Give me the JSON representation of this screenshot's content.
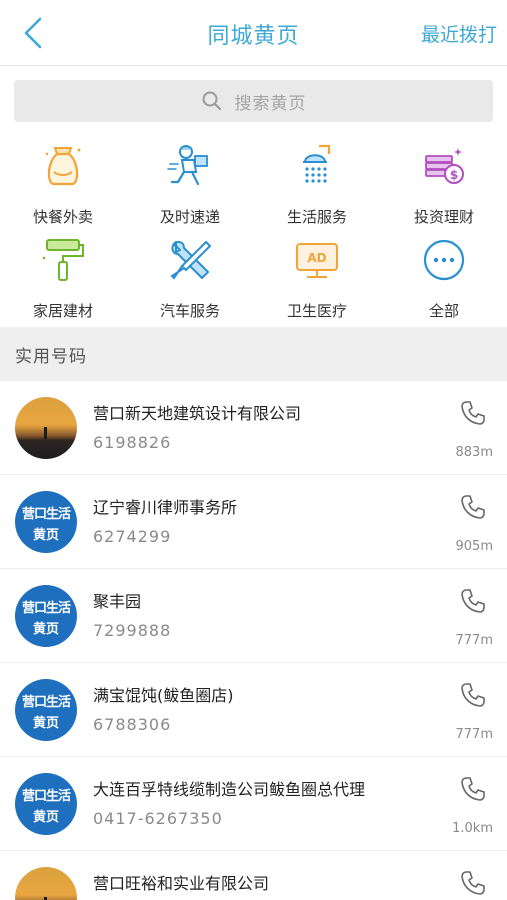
{
  "header": {
    "title": "同城黄页",
    "recent_label": "最近拨打"
  },
  "search": {
    "placeholder": "搜索黄页"
  },
  "categories": [
    {
      "label": "快餐外卖",
      "icon": "takeout-bag-icon"
    },
    {
      "label": "及时速递",
      "icon": "courier-icon"
    },
    {
      "label": "生活服务",
      "icon": "shower-icon"
    },
    {
      "label": "投资理财",
      "icon": "money-stack-icon"
    },
    {
      "label": "家居建材",
      "icon": "paint-roller-icon"
    },
    {
      "label": "汽车服务",
      "icon": "wrench-screwdriver-icon"
    },
    {
      "label": "卫生医疗",
      "icon": "ad-monitor-icon"
    },
    {
      "label": "全部",
      "icon": "more-icon"
    }
  ],
  "section": {
    "title": "实用号码"
  },
  "avatar_text": {
    "line1": "营口生活",
    "line2": "黄页"
  },
  "listings": [
    {
      "name": "营口新天地建筑设计有限公司",
      "phone": "6198826",
      "distance": "883m",
      "avatar": "sunset"
    },
    {
      "name": "辽宁睿川律师事务所",
      "phone": "6274299",
      "distance": "905m",
      "avatar": "logo"
    },
    {
      "name": "聚丰园",
      "phone": "7299888",
      "distance": "777m",
      "avatar": "logo"
    },
    {
      "name": "满宝馄饨(鲅鱼圈店)",
      "phone": "6788306",
      "distance": "777m",
      "avatar": "logo"
    },
    {
      "name": "大连百孚特线缆制造公司鲅鱼圈总代理",
      "phone": "0417-6267350",
      "distance": "1.0km",
      "avatar": "logo"
    },
    {
      "name": "营口旺裕和实业有限公司",
      "phone": "",
      "distance": "",
      "avatar": "sunset"
    }
  ],
  "colors": {
    "accent": "#3fa9d5",
    "logo_blue": "#1f6fbf"
  }
}
